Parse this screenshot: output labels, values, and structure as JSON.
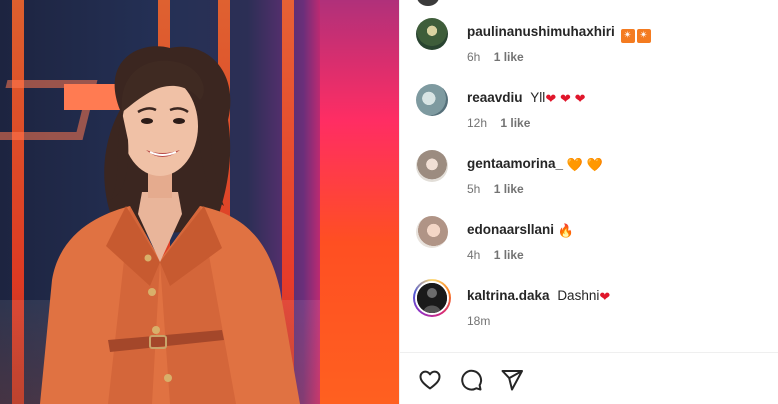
{
  "post": {
    "image_alt": "Woman in orange blazer on TV studio set"
  },
  "comments": [
    {
      "username": "paulinanushimuhaxhiri",
      "text": "",
      "emoji": [
        "✴",
        "✴"
      ],
      "time": "6h",
      "likes": "1 like",
      "avatar_color": "#3e5d3a"
    },
    {
      "username": "reaavdiu",
      "text": "Yll",
      "emoji": [
        "❤",
        "❤",
        "❤"
      ],
      "time": "12h",
      "likes": "1 like",
      "avatar_color": "#7e9aa0"
    },
    {
      "username": "gentaamorina_",
      "text": "",
      "emoji": [
        "🧡",
        "🧡"
      ],
      "time": "5h",
      "likes": "1 like",
      "avatar_color": "#9c8c80"
    },
    {
      "username": "edonaarsllani",
      "text": "",
      "emoji": [
        "🔥"
      ],
      "time": "4h",
      "likes": "1 like",
      "avatar_color": "#b09486"
    },
    {
      "username": "kaltrina.daka",
      "text": "Dashni",
      "emoji": [
        "❤"
      ],
      "time": "18m",
      "likes": "",
      "avatar_color": "#1a1a1a"
    }
  ],
  "actions": {
    "like_icon": "heart-outline-icon",
    "comment_icon": "speech-bubble-icon",
    "share_icon": "paper-plane-icon"
  },
  "colors": {
    "heart_red": "#e0162b",
    "heart_orange": "#f36a14",
    "meta_gray": "#737373",
    "text_dark": "#262626"
  }
}
